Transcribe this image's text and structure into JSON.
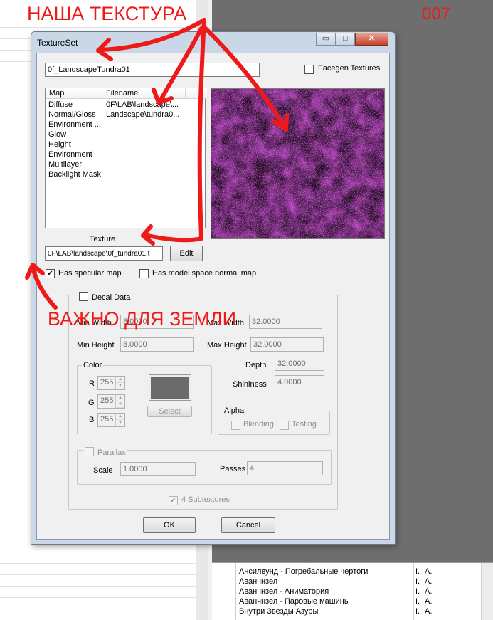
{
  "annotations": {
    "top_label": "НАША ТЕКСТУРА",
    "number": "007",
    "important_label": "ВАЖНО ДЛЯ ЗЕМЛИ",
    "color": "#ee1a1a"
  },
  "dialog": {
    "title": "TextureSet",
    "window_buttons": {
      "minimize": "▭",
      "maximize": "□",
      "close": "✕"
    },
    "editor_id": "0f_LandscapeTundra01",
    "facegen_label": "Facegen Textures",
    "facegen_checked": false,
    "list": {
      "columns": [
        "Map",
        "Filename"
      ],
      "rows": [
        {
          "map": "Diffuse",
          "file": "0F\\LAB\\landscape\\..."
        },
        {
          "map": "Normal/Gloss",
          "file": "Landscape\\tundra0..."
        },
        {
          "map": "Environment ...",
          "file": ""
        },
        {
          "map": "Glow",
          "file": ""
        },
        {
          "map": "Height",
          "file": ""
        },
        {
          "map": "Environment",
          "file": ""
        },
        {
          "map": "Multilayer",
          "file": ""
        },
        {
          "map": "Backlight Mask",
          "file": ""
        }
      ]
    },
    "texture_label": "Texture",
    "texture_path": "0F\\LAB\\landscape\\0f_tundra01.t",
    "edit_button": "Edit",
    "has_specular_label": "Has specular map",
    "has_specular_checked": true,
    "model_space_label": "Has model space normal map",
    "model_space_checked": false,
    "decal": {
      "title": "Decal Data",
      "min_width_label": "Min Width",
      "min_width": "8.0000",
      "max_width_label": "Max Width",
      "max_width": "32.0000",
      "min_height_label": "Min Height",
      "min_height": "8.0000",
      "max_height_label": "Max Height",
      "max_height": "32.0000",
      "depth_label": "Depth",
      "depth": "32.0000",
      "shininess_label": "Shininess",
      "shininess": "4.0000",
      "color": {
        "title": "Color",
        "r_label": "R",
        "r": "255",
        "g_label": "G",
        "g": "255",
        "b_label": "B",
        "b": "255",
        "select_button": "Select",
        "swatch": "#6b6b6b"
      },
      "alpha": {
        "title": "Alpha",
        "blending_label": "Blending",
        "testing_label": "Testing"
      },
      "parallax": {
        "title": "Parallax",
        "scale_label": "Scale",
        "scale": "1.0000",
        "passes_label": "Passes",
        "passes": "4"
      },
      "subtextures_label": "4 Subtextures",
      "subtextures_checked": true
    },
    "ok_button": "OK",
    "cancel_button": "Cancel"
  },
  "background_list": {
    "rows": [
      {
        "name": "Ансилвунд - Погребальные чертоги",
        "c2": "I.",
        "c3": "A."
      },
      {
        "name": "Аванчнзел",
        "c2": "I.",
        "c3": "A."
      },
      {
        "name": "Аванчнзел - Аниматория",
        "c2": "I.",
        "c3": "A."
      },
      {
        "name": "Аванчнзел - Паровые машины",
        "c2": "I.",
        "c3": "A."
      },
      {
        "name": "Внутри Звезды Азуры",
        "c2": "I.",
        "c3": "A."
      }
    ]
  }
}
